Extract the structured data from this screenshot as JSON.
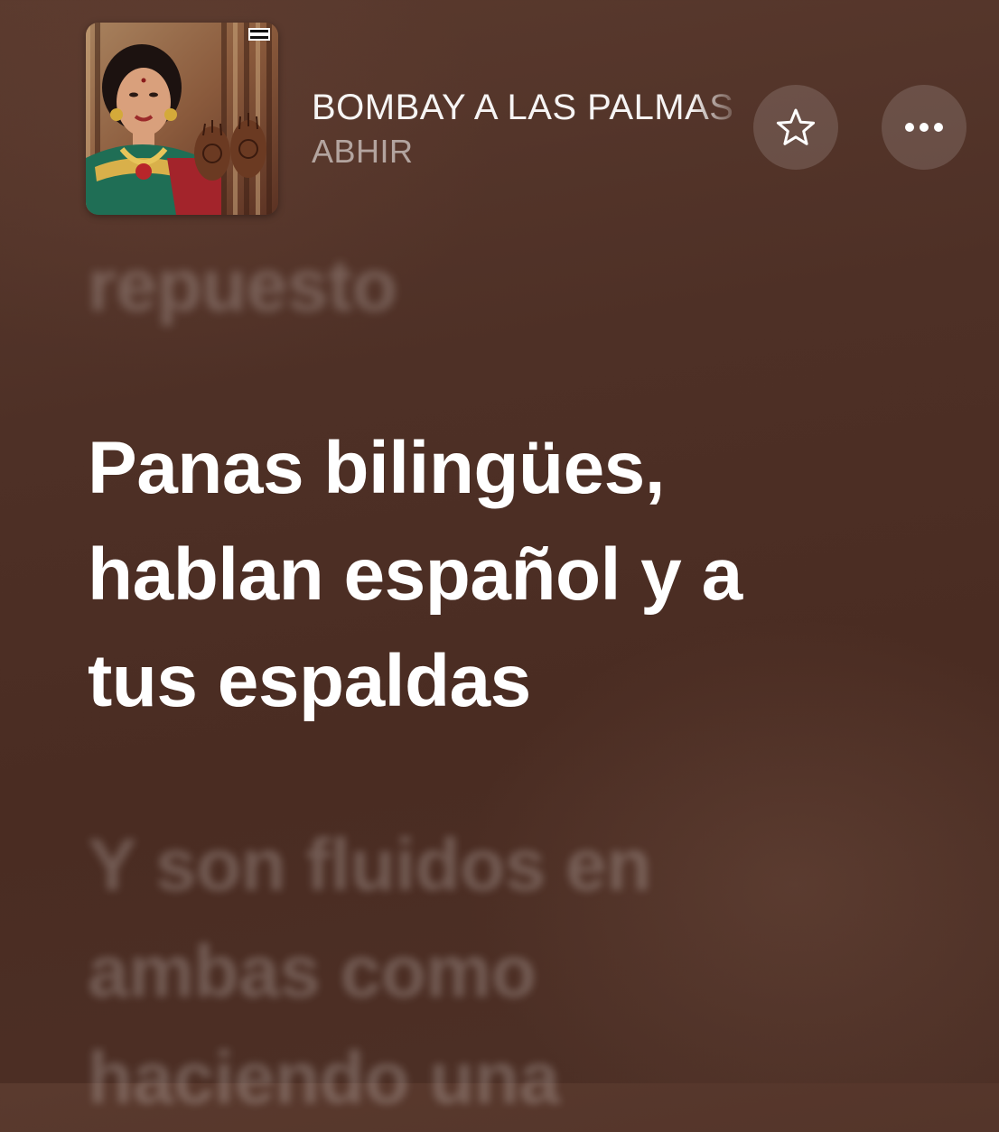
{
  "now_playing": {
    "title": "BOMBAY A LAS PALMAS",
    "artist": "ABHIR",
    "artwork_icon": "album-artwork-portrait",
    "explicit_badge": "PARENTAL ADVISORY"
  },
  "controls": {
    "favorite_icon": "star-outline-icon",
    "more_icon": "ellipsis-icon"
  },
  "lyrics": {
    "previous": "repuesto",
    "current": [
      "Panas bilingües,",
      "hablan español y a",
      "tus espaldas"
    ],
    "next": [
      "Y son fluidos en",
      "ambas como",
      "haciendo una"
    ]
  },
  "colors": {
    "background": "#4e3026",
    "active_lyric": "#ffffff",
    "inactive_lyric": "rgba(255,255,255,0.22)"
  }
}
